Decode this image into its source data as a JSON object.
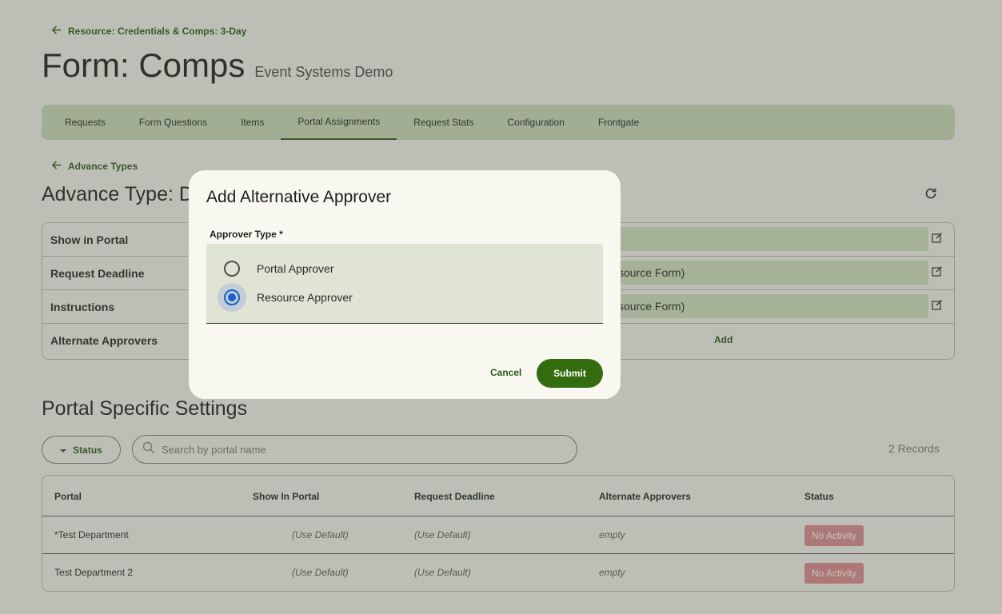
{
  "breadcrumb": {
    "label": "Resource: Credentials & Comps: 3-Day"
  },
  "page": {
    "title": "Form: Comps",
    "subtitle": "Event Systems Demo"
  },
  "tabs": [
    {
      "label": "Requests"
    },
    {
      "label": "Form Questions"
    },
    {
      "label": "Items"
    },
    {
      "label": "Portal Assignments",
      "active": true
    },
    {
      "label": "Request Stats"
    },
    {
      "label": "Configuration"
    },
    {
      "label": "Frontgate"
    }
  ],
  "advance": {
    "back_label": "Advance Types",
    "title": "Advance Type: D",
    "rows": [
      {
        "label": "Show in Portal",
        "value": ""
      },
      {
        "label": "Request Deadline",
        "value": "source Form)"
      },
      {
        "label": "Instructions",
        "value": "source Form)"
      },
      {
        "label": "Alternate Approvers",
        "action": "Add"
      }
    ]
  },
  "portal_settings": {
    "title": "Portal Specific Settings",
    "status_filter_label": "Status",
    "search_placeholder": "Search by portal name",
    "records_label": "2 Records",
    "columns": [
      "Portal",
      "Show In Portal",
      "Request Deadline",
      "Alternate Approvers",
      "Status"
    ],
    "rows": [
      {
        "portal": "*Test Department",
        "show_in_portal": "(Use Default)",
        "request_deadline": "(Use Default)",
        "alternate_approvers": "empty",
        "status": "No Activity"
      },
      {
        "portal": "Test Department 2",
        "show_in_portal": "(Use Default)",
        "request_deadline": "(Use Default)",
        "alternate_approvers": "empty",
        "status": "No Activity"
      }
    ]
  },
  "modal": {
    "title": "Add Alternative Approver",
    "field_label": "Approver Type *",
    "options": [
      {
        "label": "Portal Approver",
        "selected": false
      },
      {
        "label": "Resource Approver",
        "selected": true
      }
    ],
    "cancel_label": "Cancel",
    "submit_label": "Submit"
  },
  "colors": {
    "accent_green": "#336b0f",
    "link_green": "#2d5a14",
    "tab_bar": "#cfe0bb",
    "badge_red": "#e28c8c",
    "radio_blue": "#1660c8"
  },
  "icons": {
    "back": "arrow-left-icon",
    "refresh": "refresh-icon",
    "edit": "edit-icon",
    "dropdown": "caret-down-icon",
    "search": "search-icon"
  }
}
